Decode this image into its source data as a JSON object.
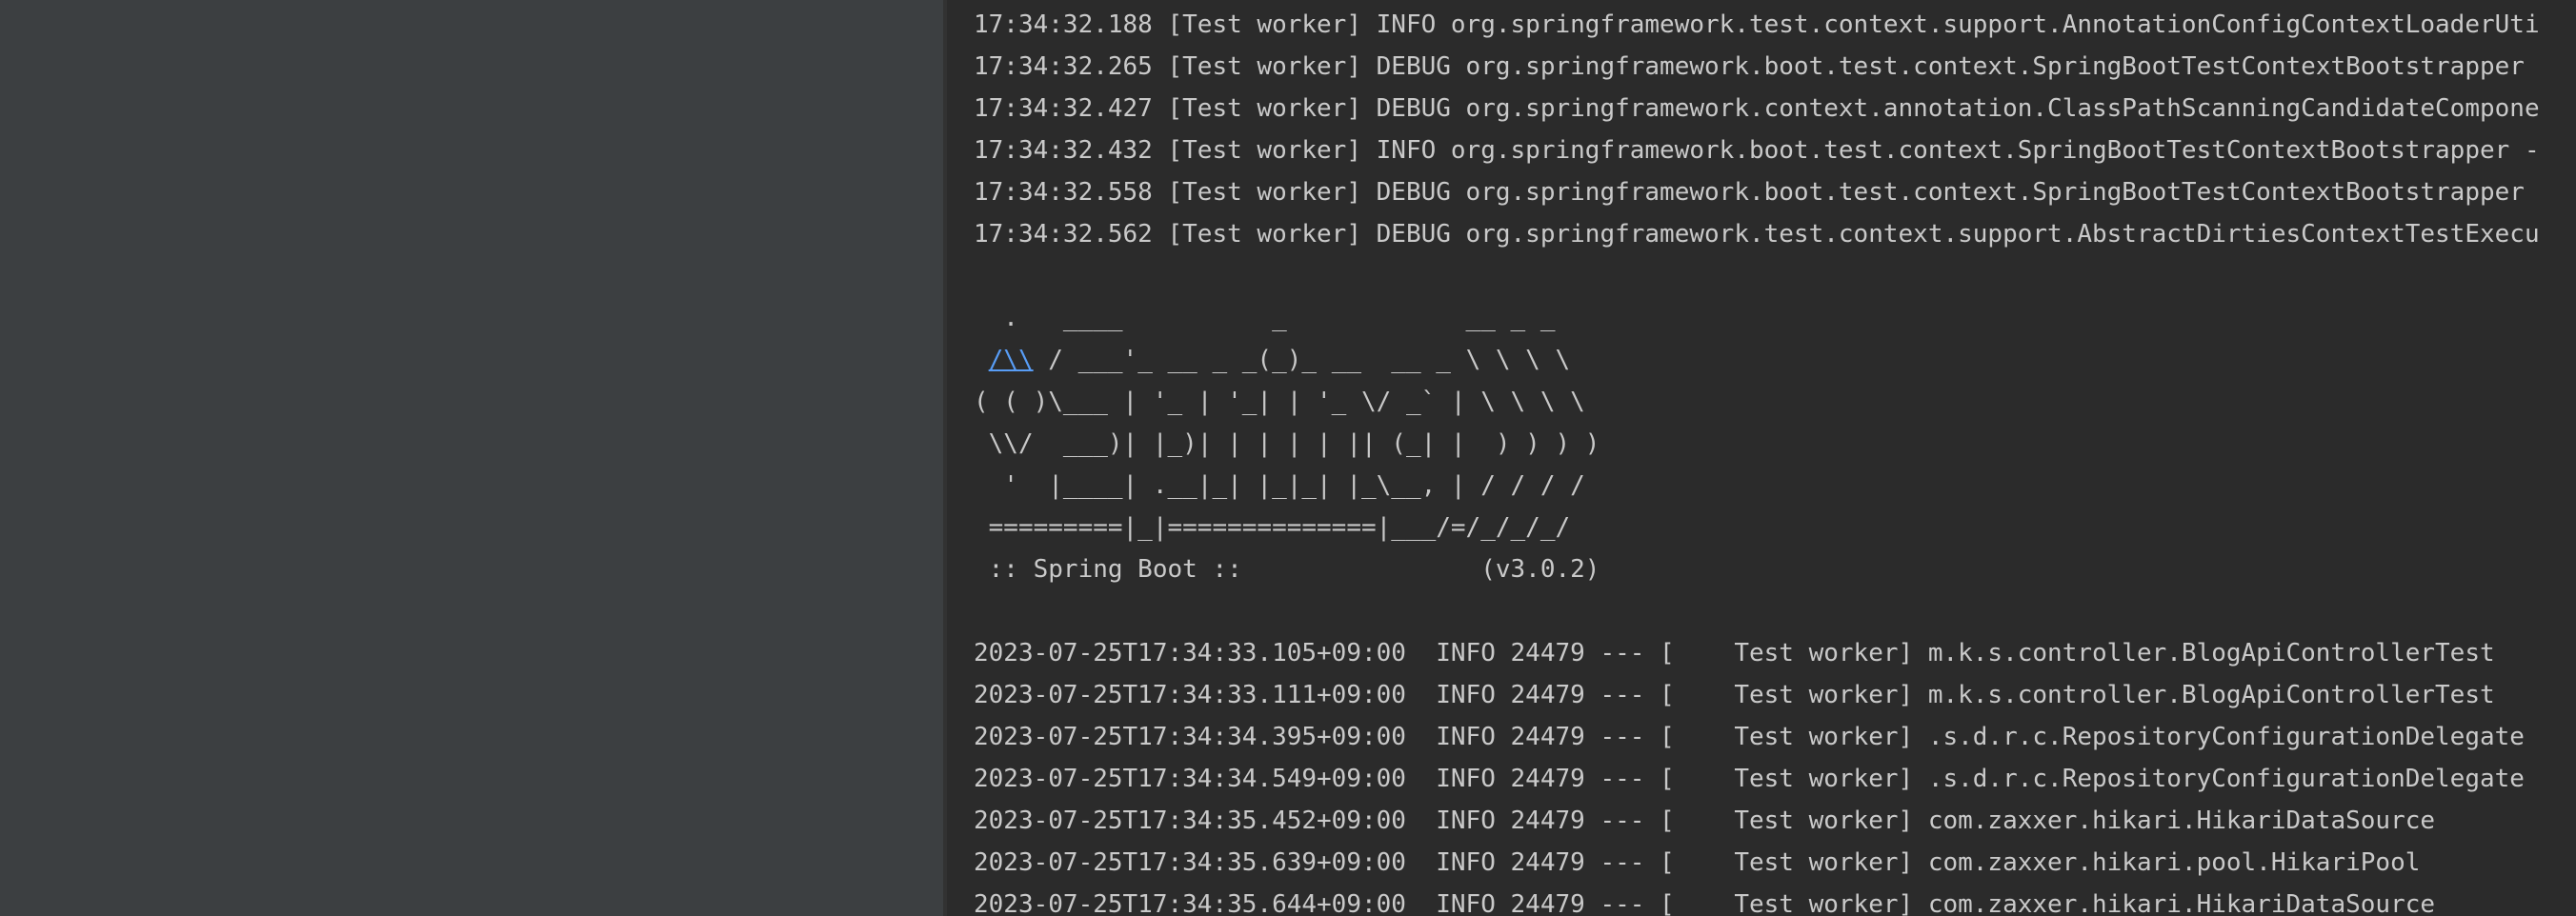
{
  "colors": {
    "left_panel_bg": "#3c3f41",
    "console_bg": "#2b2b2b",
    "text": "#c9c9c9",
    "link": "#589df6"
  },
  "console": {
    "lines": [
      "17:34:32.188 [Test worker] INFO org.springframework.test.context.support.AnnotationConfigContextLoaderUti",
      "17:34:32.265 [Test worker] DEBUG org.springframework.boot.test.context.SpringBootTestContextBootstrapper",
      "17:34:32.427 [Test worker] DEBUG org.springframework.context.annotation.ClassPathScanningCandidateCompone",
      "17:34:32.432 [Test worker] INFO org.springframework.boot.test.context.SpringBootTestContextBootstrapper -",
      "17:34:32.558 [Test worker] DEBUG org.springframework.boot.test.context.SpringBootTestContextBootstrapper",
      "17:34:32.562 [Test worker] DEBUG org.springframework.test.context.support.AbstractDirtiesContextTestExecu",
      "",
      "  .   ____          _            __ _ _",
      " /\\\\ / ___'_ __ _ _(_)_ __  __ _ \\ \\ \\ \\",
      "( ( )\\___ | '_ | '_| | '_ \\/ _` | \\ \\ \\ \\",
      " \\\\/  ___)| |_)| | | | | || (_| |  ) ) ) )",
      "  '  |____| .__|_| |_|_| |_\\__, | / / / /",
      " =========|_|==============|___/=/_/_/_/",
      " :: Spring Boot ::                (v3.0.2)",
      "",
      "2023-07-25T17:34:33.105+09:00  INFO 24479 --- [    Test worker] m.k.s.controller.BlogApiControllerTest",
      "2023-07-25T17:34:33.111+09:00  INFO 24479 --- [    Test worker] m.k.s.controller.BlogApiControllerTest",
      "2023-07-25T17:34:34.395+09:00  INFO 24479 --- [    Test worker] .s.d.r.c.RepositoryConfigurationDelegate",
      "2023-07-25T17:34:34.549+09:00  INFO 24479 --- [    Test worker] .s.d.r.c.RepositoryConfigurationDelegate",
      "2023-07-25T17:34:35.452+09:00  INFO 24479 --- [    Test worker] com.zaxxer.hikari.HikariDataSource",
      "2023-07-25T17:34:35.639+09:00  INFO 24479 --- [    Test worker] com.zaxxer.hikari.pool.HikariPool",
      "2023-07-25T17:34:35.644+09:00  INFO 24479 --- [    Test worker] com.zaxxer.hikari.HikariDataSource"
    ],
    "banner_link": {
      "text": "/\\\\",
      "rest": " / ___'_ __ _ _(_)_ __  __ _ \\ \\ \\ \\"
    }
  }
}
